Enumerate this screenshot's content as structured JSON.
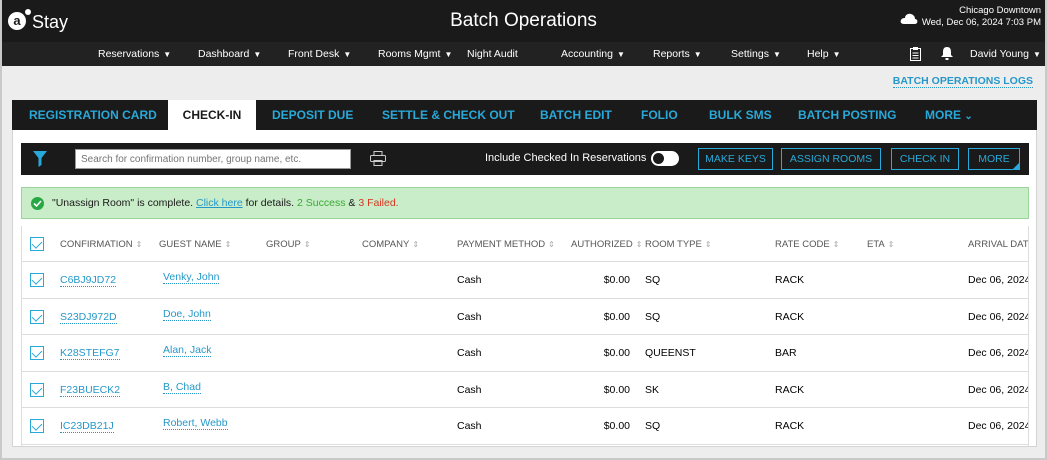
{
  "app": {
    "logo_text": "Stay",
    "title": "Batch Operations",
    "location": "Chicago Downtown",
    "datetime": "Wed, Dec 06, 2024 7:03 PM"
  },
  "menu": {
    "items": [
      "Reservations",
      "Dashboard",
      "Front Desk",
      "Rooms Mgmt",
      "Night Audit",
      "Accounting",
      "Reports",
      "Settings",
      "Help"
    ],
    "user": "David Young"
  },
  "logs_link": "BATCH OPERATIONS LOGS",
  "tabs": [
    "REGISTRATION CARD",
    "CHECK-IN",
    "DEPOSIT DUE",
    "SETTLE & CHECK OUT",
    "BATCH EDIT",
    "FOLIO",
    "BULK SMS",
    "BATCH POSTING",
    "MORE"
  ],
  "active_tab": "CHECK-IN",
  "toolbar": {
    "search_placeholder": "Search for confirmation number, group name, etc.",
    "include_label": "Include Checked In Reservations",
    "buttons": [
      "MAKE KEYS",
      "ASSIGN ROOMS",
      "CHECK IN",
      "MORE"
    ]
  },
  "banner": {
    "message": "\"Unassign Room\" is complete.",
    "link": "Click here",
    "after_link": "for details.",
    "success": "2 Success",
    "amp": "&",
    "failed": "3 Failed."
  },
  "table": {
    "columns": [
      "CONFIRMATION",
      "GUEST NAME",
      "GROUP",
      "COMPANY",
      "PAYMENT METHOD",
      "AUTHORIZED",
      "ROOM TYPE",
      "RATE CODE",
      "ETA",
      "ARRIVAL DATE"
    ],
    "rows": [
      {
        "confirmation": "C6BJ9JD72",
        "guest": "Venky, John",
        "group": "",
        "company": "",
        "payment": "Cash",
        "authorized": "$0.00",
        "room_type": "SQ",
        "rate_code": "RACK",
        "eta": "",
        "arrival": "Dec 06, 2024"
      },
      {
        "confirmation": "S23DJ972D",
        "guest": "Doe, John",
        "group": "",
        "company": "",
        "payment": "Cash",
        "authorized": "$0.00",
        "room_type": "SQ",
        "rate_code": "RACK",
        "eta": "",
        "arrival": "Dec 06, 2024"
      },
      {
        "confirmation": "K28STEFG7",
        "guest": "Alan, Jack",
        "group": "",
        "company": "",
        "payment": "Cash",
        "authorized": "$0.00",
        "room_type": "QUEENST",
        "rate_code": "BAR",
        "eta": "",
        "arrival": "Dec 06, 2024"
      },
      {
        "confirmation": "F23BUECK2",
        "guest": "B, Chad",
        "group": "",
        "company": "",
        "payment": "Cash",
        "authorized": "$0.00",
        "room_type": "SK",
        "rate_code": "RACK",
        "eta": "",
        "arrival": "Dec 06, 2024"
      },
      {
        "confirmation": "IC23DB21J",
        "guest": "Robert, Webb",
        "group": "",
        "company": "",
        "payment": "Cash",
        "authorized": "$0.00",
        "room_type": "SQ",
        "rate_code": "RACK",
        "eta": "",
        "arrival": "Dec 06, 2024"
      }
    ]
  },
  "colors": {
    "accent": "#28a9d9",
    "topbar": "#1a1a1a",
    "success_bg": "#c9ecc9",
    "success": "#3aaa35",
    "failed": "#d9361f"
  },
  "icons": [
    "logo-icon",
    "cloud-icon",
    "clipboard-icon",
    "bell-icon",
    "filter-icon",
    "printer-icon",
    "check-circle-icon",
    "chevron-down-icon"
  ]
}
